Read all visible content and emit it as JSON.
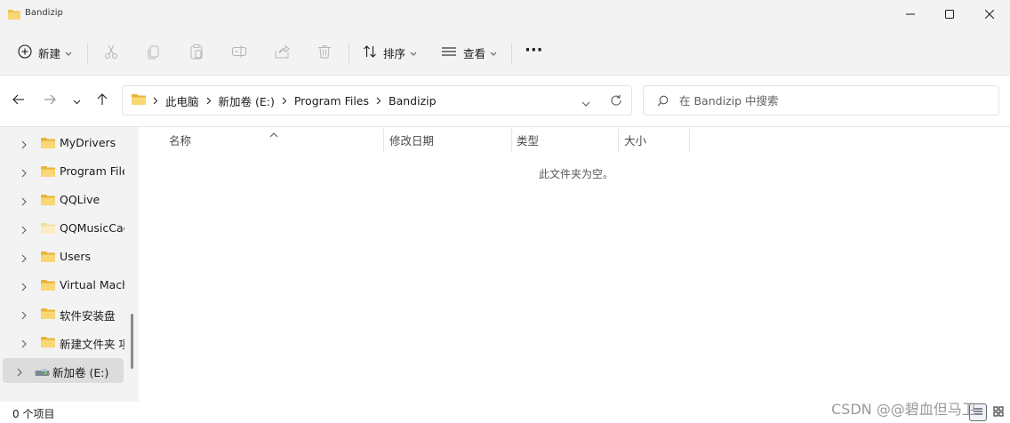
{
  "window": {
    "title": "Bandizip",
    "minimize_icon": "minimize-icon",
    "maximize_icon": "maximize-icon",
    "close_icon": "close-icon"
  },
  "toolbar": {
    "new_label": "新建",
    "sort_label": "排序",
    "view_label": "查看",
    "more_label": "···"
  },
  "address": {
    "breadcrumbs": [
      "此电脑",
      "新加卷 (E:)",
      "Program Files",
      "Bandizip"
    ]
  },
  "search": {
    "placeholder": "在 Bandizip 中搜索"
  },
  "nav": {
    "items": [
      {
        "label": "MyDrivers"
      },
      {
        "label": "Program Files"
      },
      {
        "label": "QQLive"
      },
      {
        "label": "QQMusicCache"
      },
      {
        "label": "Users"
      },
      {
        "label": "Virtual Machines"
      },
      {
        "label": "软件安装盘"
      },
      {
        "label": "新建文件夹 项目"
      },
      {
        "label": "新加卷 (E:)"
      }
    ]
  },
  "columns": {
    "name": "名称",
    "modified": "修改日期",
    "type": "类型",
    "size": "大小"
  },
  "content": {
    "empty_text": "此文件夹为空。"
  },
  "status": {
    "item_count": "0 个项目"
  },
  "watermark": "CSDN @@碧血但马卫",
  "colors": {
    "folder": "#f2c14e",
    "accent": "#005fb8"
  }
}
